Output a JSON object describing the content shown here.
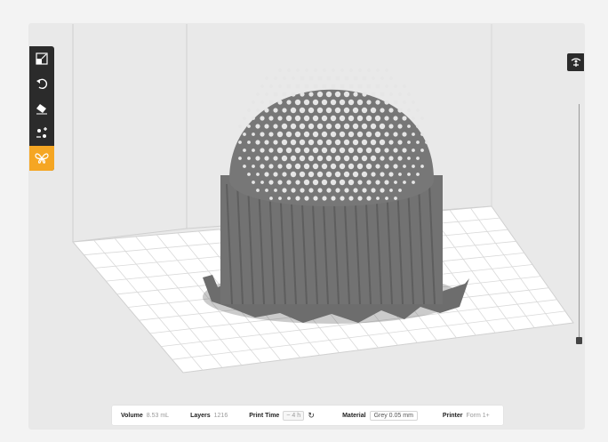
{
  "toolbar": {
    "tools": [
      {
        "name": "scale",
        "icon": "scale-icon"
      },
      {
        "name": "rotate",
        "icon": "rotate-icon"
      },
      {
        "name": "eraser",
        "icon": "eraser-icon"
      },
      {
        "name": "layout",
        "icon": "layout-icon"
      },
      {
        "name": "supports",
        "icon": "butterfly-icon",
        "active": true
      }
    ]
  },
  "right_panel": {
    "icon": "view-settings-icon"
  },
  "status": {
    "volume_label": "Volume",
    "volume_value": "8.53 mL",
    "layers_label": "Layers",
    "layers_value": "1216",
    "print_time_label": "Print Time",
    "print_time_value": "~ 4 h",
    "material_label": "Material",
    "material_value": "Grey 0.05 mm",
    "printer_label": "Printer",
    "printer_value": "Form 1+"
  },
  "colors": {
    "accent": "#f5a623",
    "toolbar_bg": "#2b2b2b",
    "viewport_bg": "#e9e9e9",
    "model": "#6e6e6e"
  }
}
